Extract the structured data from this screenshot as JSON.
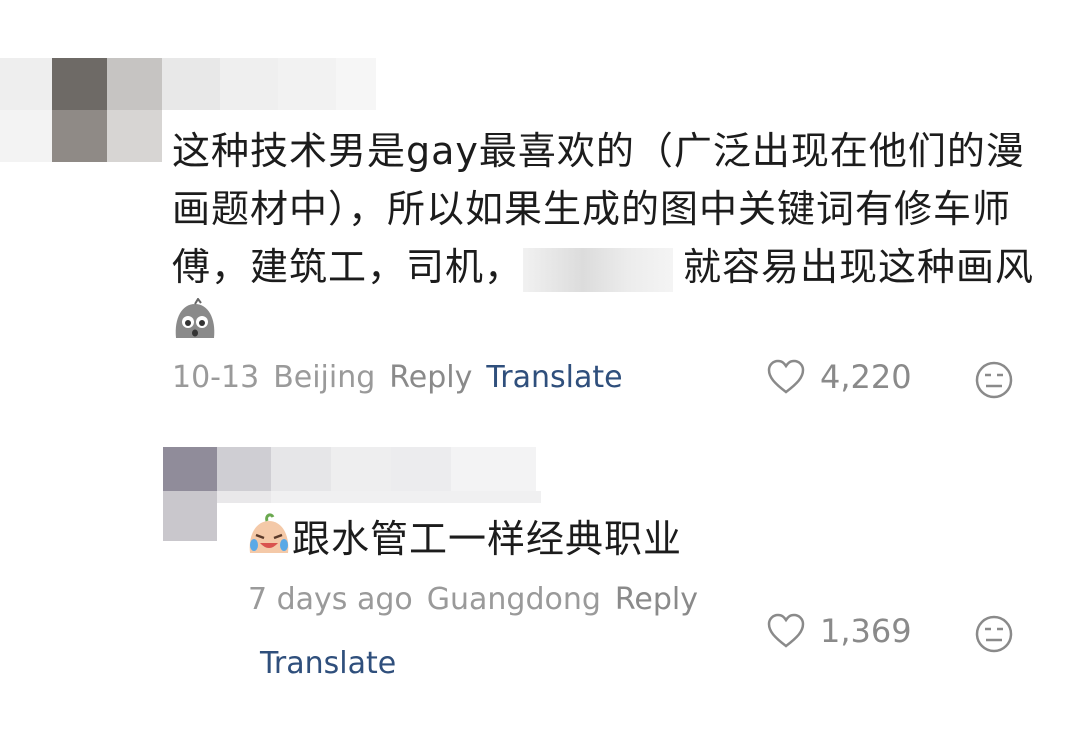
{
  "comments": [
    {
      "text_part1": "这种技术男是gay最喜欢的（广泛出现在他们的漫画题材中），所以如果生成的图中关键词有修车师傅，建筑工，司机，",
      "text_part2": "就容易出现这种画风",
      "date": "10-13",
      "location": "Beijing",
      "reply_label": "Reply",
      "translate_label": "Translate",
      "likes": "4,220",
      "emoji": "shocked-face-emoji"
    },
    {
      "text": "跟水管工一样经典职业",
      "time": "7 days ago",
      "location": "Guangdong",
      "reply_label": "Reply",
      "translate_label": "Translate",
      "likes": "1,369",
      "emoji": "crying-laughing-emoji"
    }
  ],
  "colors": {
    "text": "#1c1c1c",
    "meta": "#9a9a9a",
    "translate": "#2f4f7c"
  }
}
